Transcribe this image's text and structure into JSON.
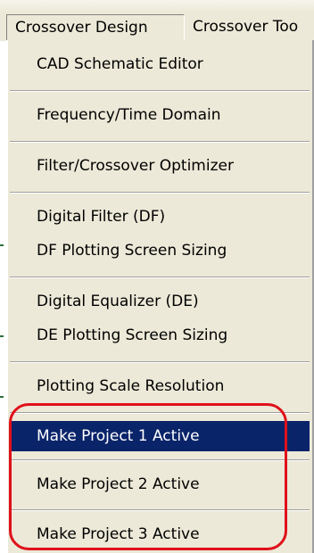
{
  "menubar": {
    "active_menu": "Crossover Design",
    "next_menu": "Crossover Too"
  },
  "dropdown": {
    "items": [
      {
        "label": "CAD Schematic Editor"
      },
      {
        "label": "Frequency/Time Domain"
      },
      {
        "label": "Filter/Crossover Optimizer"
      },
      {
        "label": "Digital Filter (DF)"
      },
      {
        "label": "DF Plotting Screen Sizing"
      },
      {
        "label": "Digital Equalizer (DE)"
      },
      {
        "label": "DE Plotting Screen Sizing"
      },
      {
        "label": "Plotting Scale Resolution"
      },
      {
        "label": "Make Project 1 Active",
        "highlighted": true
      },
      {
        "label": "Make Project 2 Active"
      },
      {
        "label": "Make Project 3 Active"
      }
    ]
  },
  "colors": {
    "menu_background": "#ece9d8",
    "highlight_background": "#0a246a",
    "highlight_text": "#ffffff",
    "annotation": "#e0101a"
  }
}
